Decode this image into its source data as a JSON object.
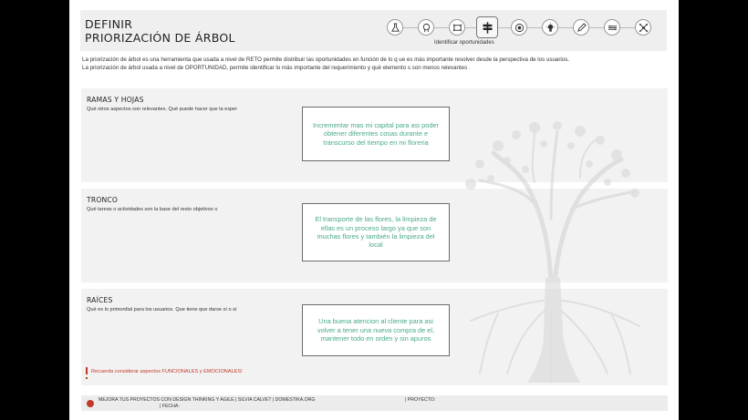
{
  "header": {
    "title_line1": "DEFINIR",
    "title_line2": "PRIORIZACIÓN DE ÁRBOL",
    "active_step_label": "Identificar oportunidades",
    "steps": [
      {
        "icon": "flask-icon"
      },
      {
        "icon": "head-icon"
      },
      {
        "icon": "frame-icon"
      },
      {
        "icon": "signpost-icon",
        "active": true
      },
      {
        "icon": "target-icon"
      },
      {
        "icon": "lightbulb-icon"
      },
      {
        "icon": "pencil-icon"
      },
      {
        "icon": "grid-icon"
      },
      {
        "icon": "network-icon"
      }
    ]
  },
  "intro": {
    "line1": "La priorización de árbol es una herramienta que usada a nivel de RETO permite distribuir las oportunidades en función de lo q ue es más importante resolver desde la perspectiva de los usuarios.",
    "line2": "La priorización de árbol usada a nivel de OPORTUNIDAD, permite identificar lo más importante del requerimiento y qué elemento s son menos relevantes ."
  },
  "sections": [
    {
      "title": "RAMAS Y HOJAS",
      "question": "Qué otros aspectos son relevantes. Qué puede hacer que la exper",
      "note": "Incrementar mas mi capital para asi poder obtener diferentes cosas durante e transcurso del tiempo en mi floreria"
    },
    {
      "title": "TRONCO",
      "question": "Qué tareas o actividades son la base del resto objetivos o",
      "note": "El transporte de las flores, la limpieza de ellas es un proceso largo ya que son muchas flores y también la limpieza del local"
    },
    {
      "title": "RAÍCES",
      "question": "Qué es lo primordial para los usuarios. Que tiene que darse sí o sí",
      "note": "Una buena atencion al cliente para asi volver a tener una nueva compra de el, mantener todo en orden y sin apuros"
    }
  ],
  "reminder": "Recuerda considerar aspectos FUNCIONALES y EMOCIONALES!",
  "footer": {
    "left": "MEJORA TUS PROYECTOS CON DESIGN THINKING Y AGILE   |   SILVIA CALVET   |   DOMESTIKA.ORG",
    "project": "| PROYECTO:",
    "date": "| FECHA:"
  },
  "colors": {
    "note_text": "#49a98c",
    "accent": "#c0392b",
    "panel_bg": "#f2f2f2"
  }
}
